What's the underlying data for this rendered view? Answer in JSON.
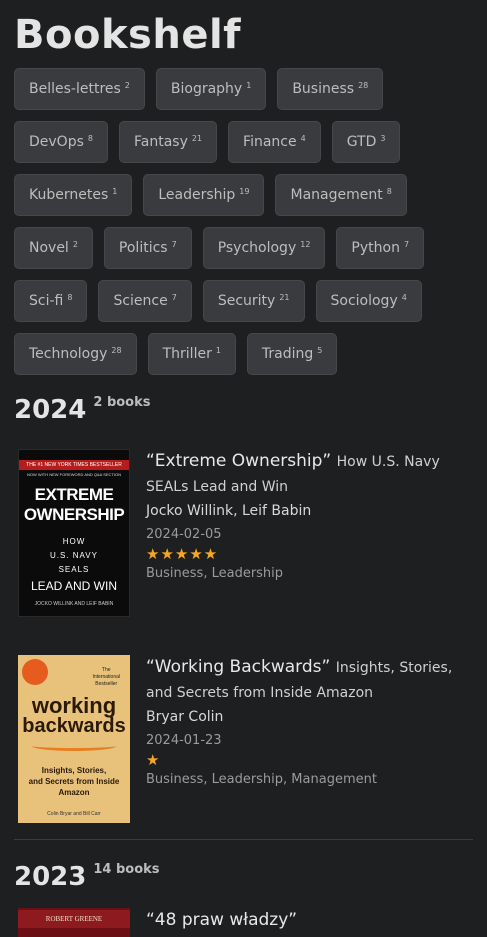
{
  "title": "Bookshelf",
  "tags": [
    {
      "name": "Belles-lettres",
      "count": "2"
    },
    {
      "name": "Biography",
      "count": "1"
    },
    {
      "name": "Business",
      "count": "28"
    },
    {
      "name": "DevOps",
      "count": "8"
    },
    {
      "name": "Fantasy",
      "count": "21"
    },
    {
      "name": "Finance",
      "count": "4"
    },
    {
      "name": "GTD",
      "count": "3"
    },
    {
      "name": "Kubernetes",
      "count": "1"
    },
    {
      "name": "Leadership",
      "count": "19"
    },
    {
      "name": "Management",
      "count": "8"
    },
    {
      "name": "Novel",
      "count": "2"
    },
    {
      "name": "Politics",
      "count": "7"
    },
    {
      "name": "Psychology",
      "count": "12"
    },
    {
      "name": "Python",
      "count": "7"
    },
    {
      "name": "Sci-fi",
      "count": "8"
    },
    {
      "name": "Science",
      "count": "7"
    },
    {
      "name": "Security",
      "count": "21"
    },
    {
      "name": "Sociology",
      "count": "4"
    },
    {
      "name": "Technology",
      "count": "28"
    },
    {
      "name": "Thriller",
      "count": "1"
    },
    {
      "name": "Trading",
      "count": "5"
    }
  ],
  "years": [
    {
      "year": "2024",
      "count_label": "2 books",
      "books": [
        {
          "title": "“Extreme Ownership”",
          "subtitle": "How U.S. Navy SEALs Lead and Win",
          "authors": "Jocko Willink, Leif Babin",
          "date": "2024-02-05",
          "rating": 5,
          "stars": "★★★★★",
          "categories": "Business, Leadership",
          "cover": {
            "top": "THE #1 NEW YORK TIMES BESTSELLER",
            "top2": "NOW WITH NEW FOREWORD AND Q&A SECTION",
            "line1": "EXTREME",
            "line2": "OWNERSHIP",
            "how": "HOW",
            "us": "U.S. NAVY",
            "seals": "SEALS",
            "lead": "LEAD AND WIN",
            "authors": "JOCKO WILLINK AND LEIF BABIN"
          }
        },
        {
          "title": "“Working Backwards”",
          "subtitle": "Insights, Stories, and Secrets from Inside Amazon",
          "authors": "Bryar Colin",
          "date": "2024-01-23",
          "rating": 1,
          "stars": "★",
          "categories": "Business, Leadership, Management",
          "cover": {
            "intl1": "The",
            "intl2": "International",
            "intl3": "Bestseller",
            "w1": "working",
            "w2": "backwards",
            "sub1": "Insights, Stories,",
            "sub2": "and Secrets from Inside",
            "sub3": "Amazon",
            "authors": "Colin Bryar and Bill Carr"
          }
        }
      ]
    },
    {
      "year": "2023",
      "count_label": "14 books",
      "books": [
        {
          "title": "“48 praw władzy”",
          "cover": {
            "author": "ROBERT GREENE"
          }
        }
      ]
    }
  ]
}
